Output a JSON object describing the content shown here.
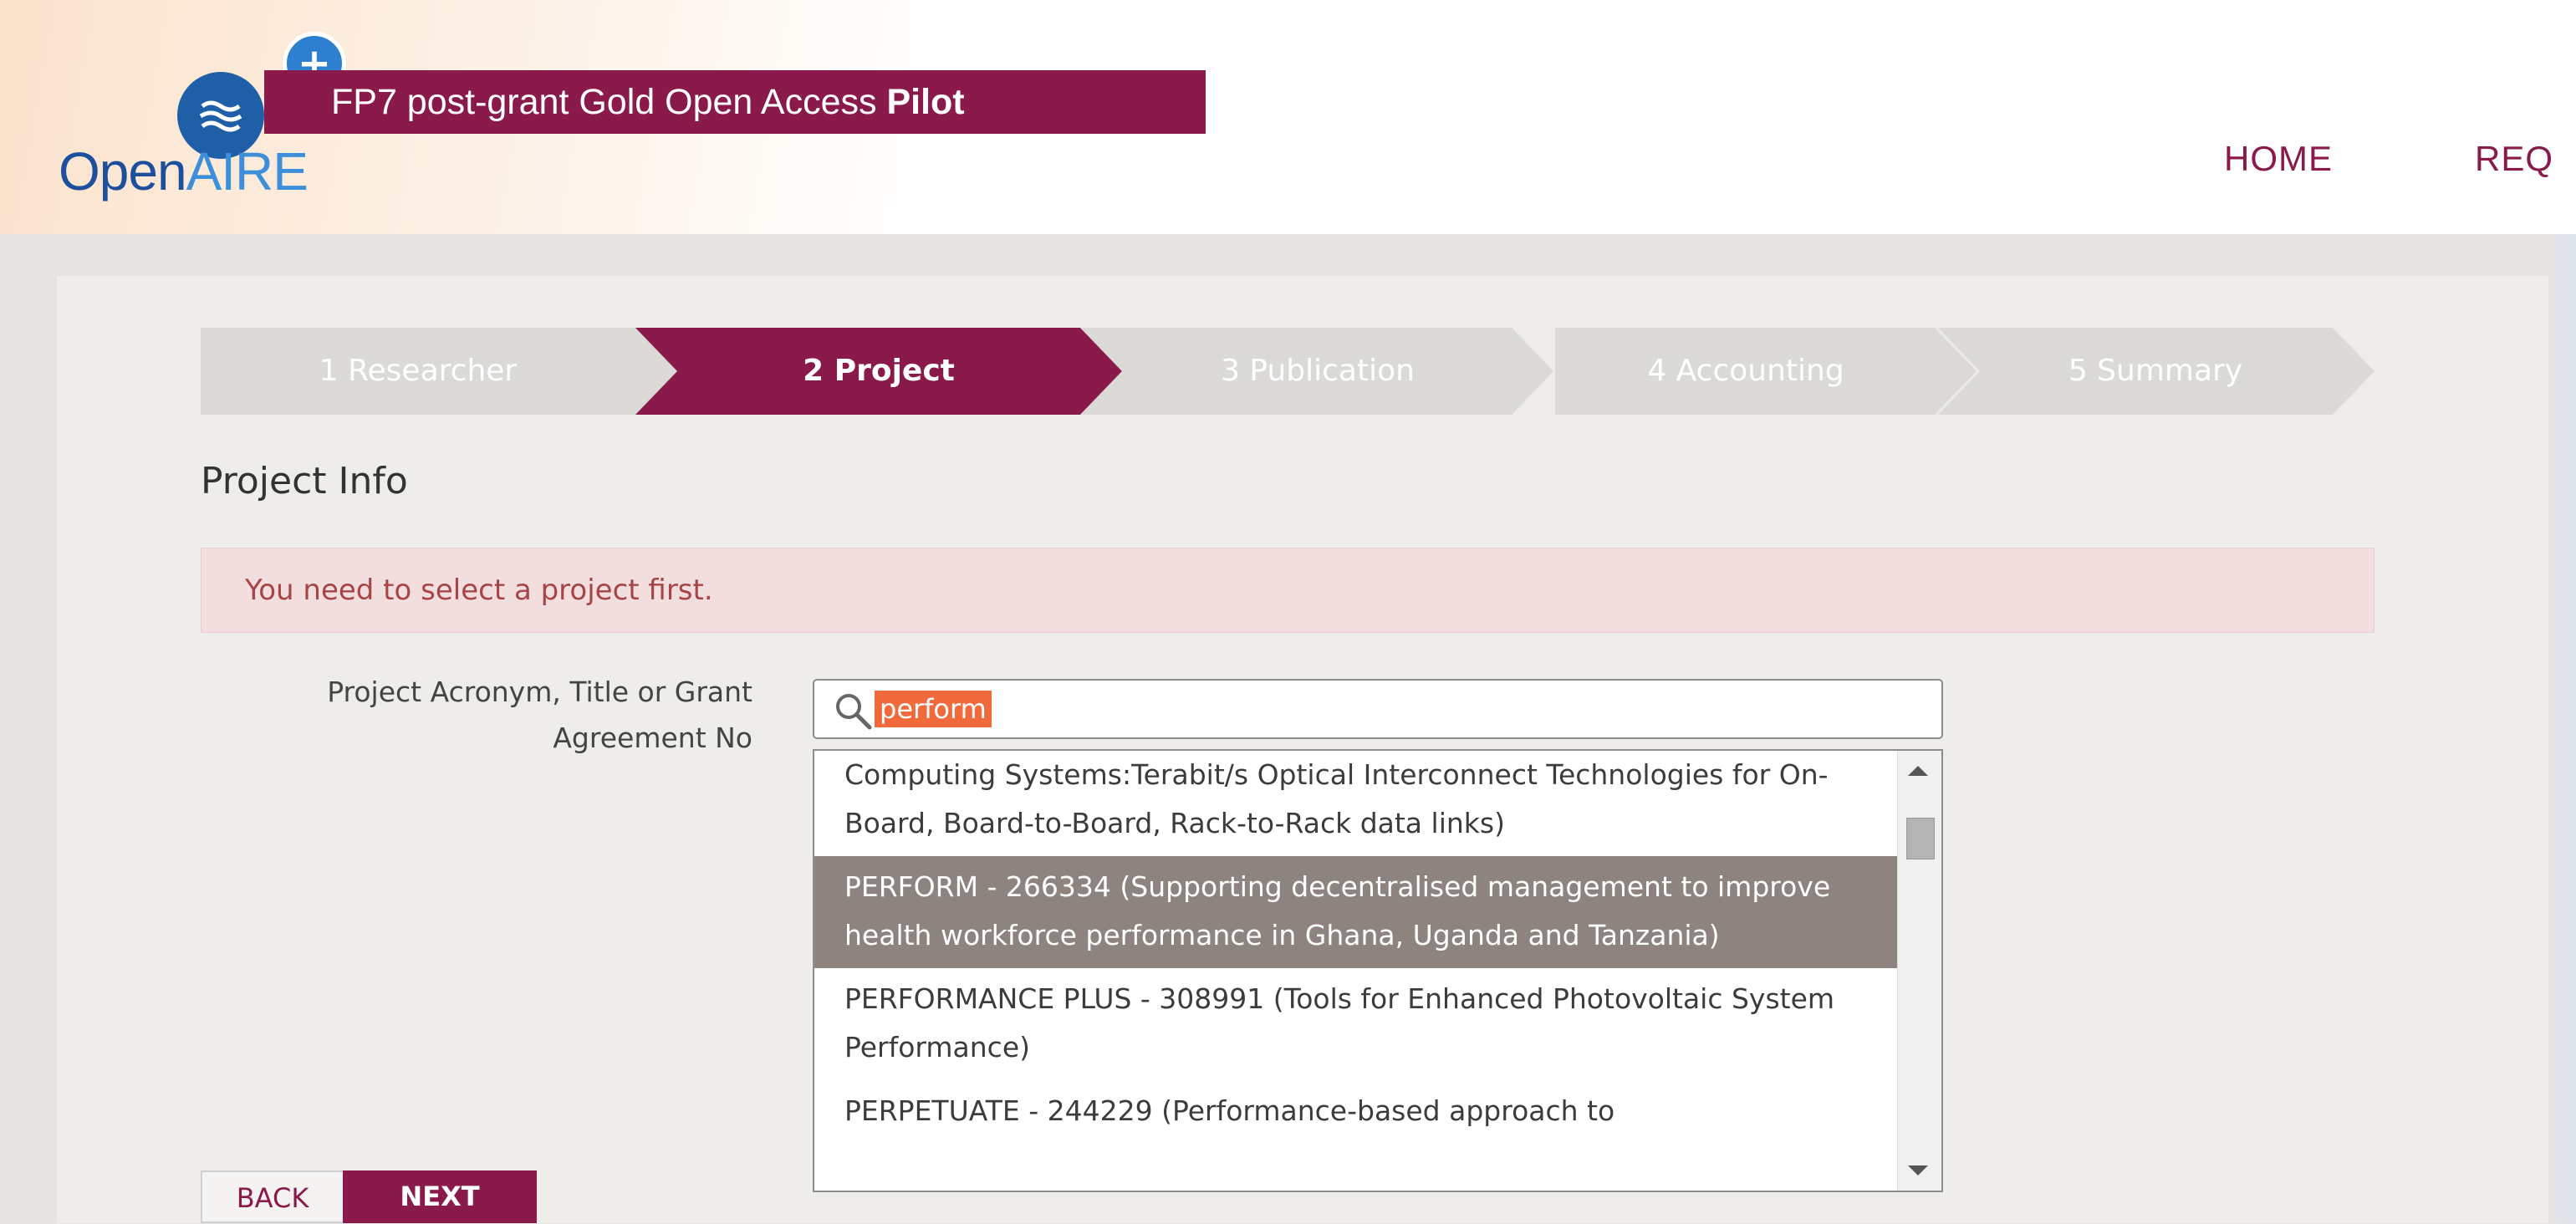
{
  "header": {
    "banner_text": "FP7 post-grant Gold Open Access ",
    "banner_bold": "Pilot",
    "brand_open": "Open",
    "brand_aire": "AIRE",
    "plus": "+",
    "nav": [
      {
        "label": "HOME"
      },
      {
        "label": "REQ"
      }
    ]
  },
  "wizard": {
    "steps": [
      {
        "label": "1 Researcher",
        "state": "done"
      },
      {
        "label": "2 Project",
        "state": "active"
      },
      {
        "label": "3 Publication",
        "state": "pending"
      },
      {
        "label": "4 Accounting",
        "state": "pending"
      },
      {
        "label": "5 Summary",
        "state": "pending"
      }
    ]
  },
  "section": {
    "title": "Project Info"
  },
  "alert": {
    "message": "You need to select a project first."
  },
  "field": {
    "label_line1": "Project Acronym, Title or Grant",
    "label_line2": "Agreement No",
    "search_value": "perform"
  },
  "dropdown": {
    "items": [
      {
        "text": "Computing Systems:Terabit/s Optical Interconnect Technologies for On-Board, Board-to-Board, Rack-to-Rack data links)",
        "selected": false
      },
      {
        "text": "PERFORM - 266334 (Supporting decentralised management to improve health workforce performance in Ghana, Uganda and Tanzania)",
        "selected": true
      },
      {
        "text": "PERFORMANCE PLUS - 308991 (Tools for Enhanced Photovoltaic System Performance)",
        "selected": false
      },
      {
        "text": "PERPETUATE - 244229 (Performance-based approach to",
        "selected": false
      }
    ]
  },
  "buttons": {
    "back": "BACK",
    "next": "NEXT"
  },
  "colors": {
    "accent": "#8a1a4a",
    "step_inactive": "#dcdad6",
    "selected_row": "#8e847f",
    "alert_bg": "#f2dedf"
  }
}
